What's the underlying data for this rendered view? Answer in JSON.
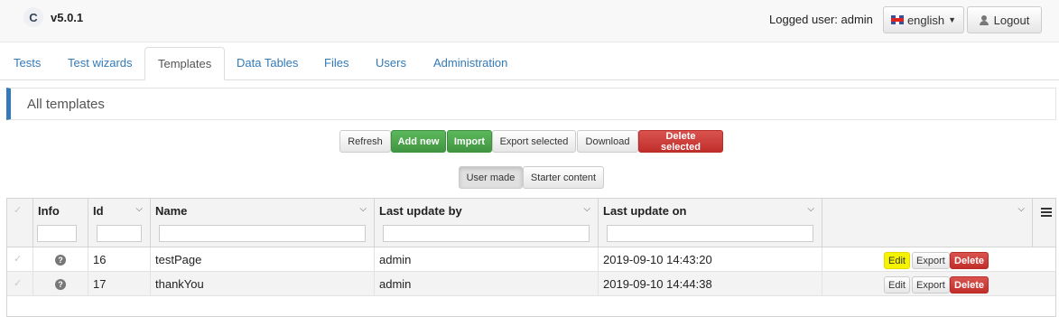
{
  "app": {
    "logo_letter": "C",
    "version": "v5.0.1"
  },
  "header": {
    "logged_user_text": "Logged user: admin",
    "language": "english",
    "logout": "Logout"
  },
  "tabs": [
    {
      "label": "Tests",
      "active": false
    },
    {
      "label": "Test wizards",
      "active": false
    },
    {
      "label": "Templates",
      "active": true
    },
    {
      "label": "Data Tables",
      "active": false
    },
    {
      "label": "Files",
      "active": false
    },
    {
      "label": "Users",
      "active": false
    },
    {
      "label": "Administration",
      "active": false
    }
  ],
  "panel": {
    "title": "All templates"
  },
  "toolbar": {
    "refresh": "Refresh",
    "add_new": "Add new",
    "import": "Import",
    "export_selected": "Export selected",
    "download": "Download",
    "delete_selected": "Delete selected"
  },
  "filter_toggle": {
    "user_made": "User made",
    "starter_content": "Starter content",
    "selected": "User made"
  },
  "grid": {
    "columns": [
      "Info",
      "Id",
      "Name",
      "Last update by",
      "Last update on"
    ],
    "rows": [
      {
        "id": "16",
        "name": "testPage",
        "updated_by": "admin",
        "updated_on": "2019-09-10 14:43:20"
      },
      {
        "id": "17",
        "name": "thankYou",
        "updated_by": "admin",
        "updated_on": "2019-09-10 14:44:38"
      }
    ],
    "actions": {
      "edit": "Edit",
      "export": "Export",
      "delete": "Delete"
    },
    "info_icon": "question-circle-icon",
    "check_icon": "check-icon",
    "menu_icon": "hamburger-menu-icon"
  },
  "colors": {
    "link": "#337ab7",
    "success": "#5cb85c",
    "danger": "#d9534f",
    "highlight": "#f4f400"
  }
}
